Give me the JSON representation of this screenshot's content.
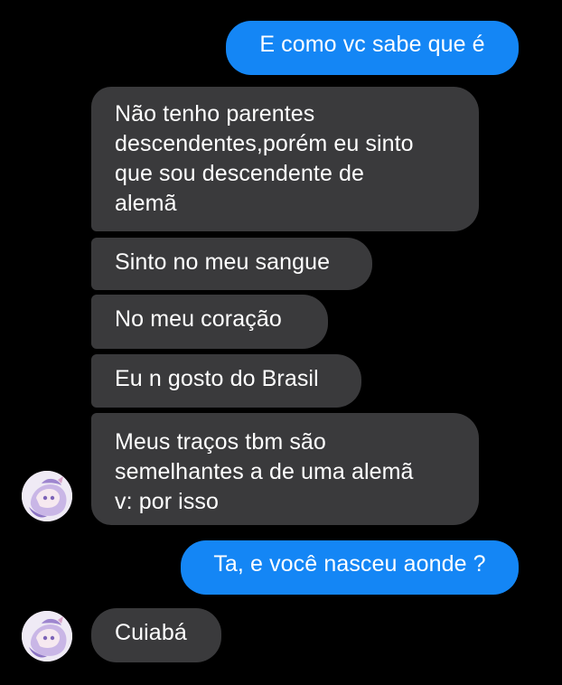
{
  "conversation": {
    "messages": [
      {
        "sender": "me",
        "text": "E como vc sabe que é"
      },
      {
        "sender": "them",
        "text": "Não tenho parentes\ndescendentes,porém eu sinto\nque sou descendente de\nalemã"
      },
      {
        "sender": "them",
        "text": "Sinto no meu sangue"
      },
      {
        "sender": "them",
        "text": "No meu coração"
      },
      {
        "sender": "them",
        "text": "Eu n gosto do Brasil"
      },
      {
        "sender": "them",
        "text": "Meus traços tbm são\nsemelhantes a de uma alemã\nv: por isso"
      },
      {
        "sender": "me",
        "text": "Ta, e você nasceu aonde ?"
      },
      {
        "sender": "them",
        "text": "Cuiabá"
      }
    ]
  },
  "colors": {
    "background": "#000000",
    "sent_bubble": "#1486f5",
    "received_bubble": "#3a3a3c",
    "text": "#ffffff"
  }
}
